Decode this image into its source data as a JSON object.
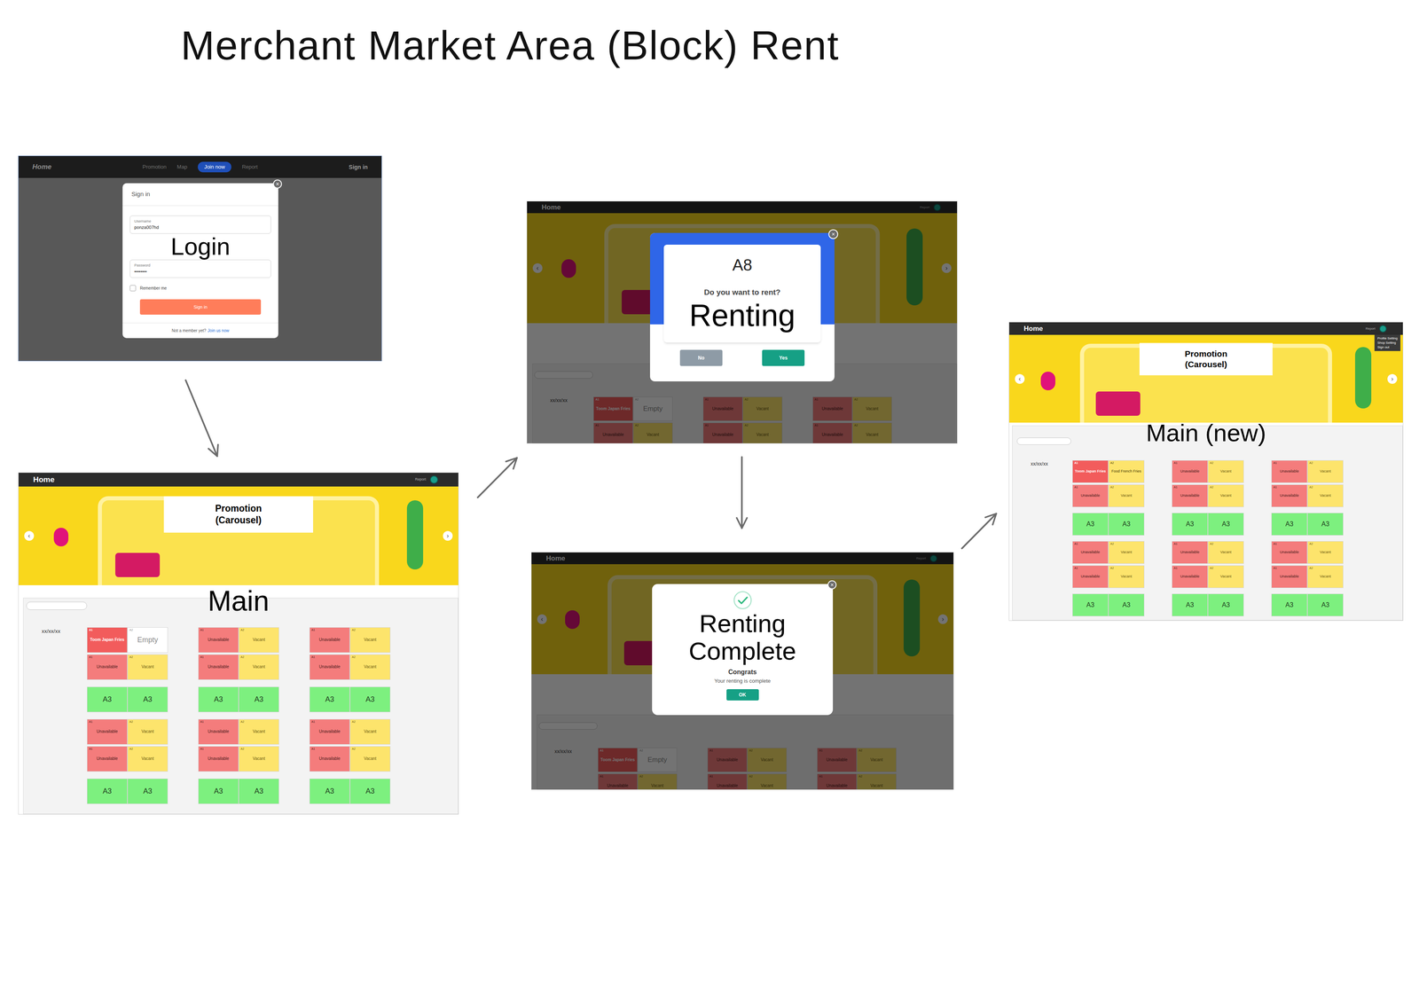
{
  "title": "Merchant Market Area (Block) Rent",
  "login": {
    "label": "Login",
    "nav": {
      "brand": "Home",
      "links": [
        {
          "label": "Promotion",
          "selected": false
        },
        {
          "label": "Map",
          "selected": false
        },
        {
          "label": "Join now",
          "selected": true
        },
        {
          "label": "Report",
          "selected": false
        }
      ],
      "signin": "Sign in"
    },
    "modal": {
      "title": "Sign in",
      "close": "×",
      "fields": [
        {
          "label": "Username",
          "value": "ponza007hd"
        },
        {
          "label": "Password",
          "value": "••••••••"
        }
      ],
      "remember": {
        "label": "Remember me",
        "checked": false
      },
      "button": "Sign in",
      "footer": "Not a member yet?",
      "link": "Join us now"
    }
  },
  "main": {
    "label": "Main",
    "nav": {
      "brand": "Home",
      "report": "Report"
    },
    "carousel": {
      "prev": "‹",
      "next": "›",
      "promo": "Promotion (Carousel)"
    },
    "date": "xx/xx/xx",
    "groups": [
      [
        [
          {
            "label": "A1",
            "text": "Toom Japan Fries",
            "status": "owned"
          },
          {
            "label": "A2",
            "text": "Empty",
            "status": "empty"
          }
        ],
        [
          {
            "label": "A1",
            "text": "Unavailable",
            "status": "occupied"
          },
          {
            "label": "A2",
            "text": "Vacant",
            "status": "vacant"
          }
        ],
        [
          {
            "text": "A3",
            "status": "available"
          },
          {
            "text": "A3",
            "status": "available"
          }
        ],
        [
          {
            "label": "A1",
            "text": "Unavailable",
            "status": "occupied"
          },
          {
            "label": "A2",
            "text": "Vacant",
            "status": "vacant"
          }
        ],
        [
          {
            "label": "A1",
            "text": "Unavailable",
            "status": "occupied"
          },
          {
            "label": "A2",
            "text": "Vacant",
            "status": "vacant"
          }
        ],
        [
          {
            "text": "A3",
            "status": "available"
          },
          {
            "text": "A3",
            "status": "available"
          }
        ]
      ],
      [
        [
          {
            "label": "A1",
            "text": "Unavailable",
            "status": "occupied"
          },
          {
            "label": "A2",
            "text": "Vacant",
            "status": "vacant"
          }
        ],
        [
          {
            "label": "A1",
            "text": "Unavailable",
            "status": "occupied"
          },
          {
            "label": "A2",
            "text": "Vacant",
            "status": "vacant"
          }
        ],
        [
          {
            "text": "A3",
            "status": "available"
          },
          {
            "text": "A3",
            "status": "available"
          }
        ],
        [
          {
            "label": "A1",
            "text": "Unavailable",
            "status": "occupied"
          },
          {
            "label": "A2",
            "text": "Vacant",
            "status": "vacant"
          }
        ],
        [
          {
            "label": "A1",
            "text": "Unavailable",
            "status": "occupied"
          },
          {
            "label": "A2",
            "text": "Vacant",
            "status": "vacant"
          }
        ],
        [
          {
            "text": "A3",
            "status": "available"
          },
          {
            "text": "A3",
            "status": "available"
          }
        ]
      ],
      [
        [
          {
            "label": "A1",
            "text": "Unavailable",
            "status": "occupied"
          },
          {
            "label": "A2",
            "text": "Vacant",
            "status": "vacant"
          }
        ],
        [
          {
            "label": "A1",
            "text": "Unavailable",
            "status": "occupied"
          },
          {
            "label": "A2",
            "text": "Vacant",
            "status": "vacant"
          }
        ],
        [
          {
            "text": "A3",
            "status": "available"
          },
          {
            "text": "A3",
            "status": "available"
          }
        ],
        [
          {
            "label": "A1",
            "text": "Unavailable",
            "status": "occupied"
          },
          {
            "label": "A2",
            "text": "Vacant",
            "status": "vacant"
          }
        ],
        [
          {
            "label": "A1",
            "text": "Unavailable",
            "status": "occupied"
          },
          {
            "label": "A2",
            "text": "Vacant",
            "status": "vacant"
          }
        ],
        [
          {
            "text": "A3",
            "status": "available"
          },
          {
            "text": "A3",
            "status": "available"
          }
        ]
      ]
    ]
  },
  "renting": {
    "screen": {
      "nav": {
        "brand": "Home",
        "report": "Report"
      },
      "carousel": {
        "prev": "‹",
        "next": "›"
      },
      "date": "xx/xx/xx",
      "groups": [
        [
          [
            {
              "label": "A1",
              "text": "Toom Japan Fries",
              "status": "owned"
            },
            {
              "label": "A2",
              "text": "Empty",
              "status": "empty"
            }
          ],
          [
            {
              "label": "A1",
              "text": "Unavailable",
              "status": "occupied"
            },
            {
              "label": "A2",
              "text": "Vacant",
              "status": "vacant"
            }
          ]
        ],
        [
          [
            {
              "label": "A1",
              "text": "Unavailable",
              "status": "occupied"
            },
            {
              "label": "A2",
              "text": "Vacant",
              "status": "vacant"
            }
          ],
          [
            {
              "label": "A1",
              "text": "Unavailable",
              "status": "occupied"
            },
            {
              "label": "A2",
              "text": "Vacant",
              "status": "vacant"
            }
          ]
        ],
        [
          [
            {
              "label": "A1",
              "text": "Unavailable",
              "status": "occupied"
            },
            {
              "label": "A2",
              "text": "Vacant",
              "status": "vacant"
            }
          ],
          [
            {
              "label": "A1",
              "text": "Unavailable",
              "status": "occupied"
            },
            {
              "label": "A2",
              "text": "Vacant",
              "status": "vacant"
            }
          ]
        ]
      ]
    },
    "dialog": {
      "block": "A8",
      "question": "Do you want to rent?",
      "label": "Renting",
      "close": "×",
      "buttons": [
        {
          "label": "No",
          "kind": "secondary"
        },
        {
          "label": "Yes",
          "kind": "primary"
        }
      ]
    }
  },
  "complete": {
    "screen": {
      "nav": {
        "brand": "Home",
        "report": "Report"
      },
      "carousel": {
        "prev": "‹",
        "next": "›"
      },
      "date": "xx/xx/xx",
      "groups": [
        [
          [
            {
              "label": "A1",
              "text": "Toom Japan Fries",
              "status": "owned"
            },
            {
              "label": "A2",
              "text": "Empty",
              "status": "empty"
            }
          ],
          [
            {
              "label": "A1",
              "text": "Unavailable",
              "status": "occupied"
            },
            {
              "label": "A2",
              "text": "Vacant",
              "status": "vacant"
            }
          ]
        ],
        [
          [
            {
              "label": "A1",
              "text": "Unavailable",
              "status": "occupied"
            },
            {
              "label": "A2",
              "text": "Vacant",
              "status": "vacant"
            }
          ],
          [
            {
              "label": "A1",
              "text": "Unavailable",
              "status": "occupied"
            },
            {
              "label": "A2",
              "text": "Vacant",
              "status": "vacant"
            }
          ]
        ],
        [
          [
            {
              "label": "A1",
              "text": "Unavailable",
              "status": "occupied"
            },
            {
              "label": "A2",
              "text": "Vacant",
              "status": "vacant"
            }
          ],
          [
            {
              "label": "A1",
              "text": "Unavailable",
              "status": "occupied"
            },
            {
              "label": "A2",
              "text": "Vacant",
              "status": "vacant"
            }
          ]
        ]
      ]
    },
    "dialog": {
      "label": "Renting Complete",
      "heading": "Congrats",
      "message": "Your renting is complete",
      "button": "OK",
      "close": "×"
    }
  },
  "main_new": {
    "label": "Main (new)",
    "nav": {
      "brand": "Home",
      "report": "Report",
      "menu": [
        "Profile Setting",
        "Shop Setting",
        "Sign out"
      ]
    },
    "carousel": {
      "prev": "‹",
      "next": "›",
      "promo": "Promotion (Carousel)"
    },
    "date": "xx/xx/xx",
    "groups": [
      [
        [
          {
            "label": "A1",
            "text": "Toom Japan Fries",
            "status": "owned"
          },
          {
            "label": "A2",
            "text": "Food French Fries",
            "status": "rented"
          }
        ],
        [
          {
            "label": "A1",
            "text": "Unavailable",
            "status": "occupied"
          },
          {
            "label": "A2",
            "text": "Vacant",
            "status": "vacant"
          }
        ],
        [
          {
            "text": "A3",
            "status": "available"
          },
          {
            "text": "A3",
            "status": "available"
          }
        ],
        [
          {
            "label": "A1",
            "text": "Unavailable",
            "status": "occupied"
          },
          {
            "label": "A2",
            "text": "Vacant",
            "status": "vacant"
          }
        ],
        [
          {
            "label": "A1",
            "text": "Unavailable",
            "status": "occupied"
          },
          {
            "label": "A2",
            "text": "Vacant",
            "status": "vacant"
          }
        ],
        [
          {
            "text": "A3",
            "status": "available"
          },
          {
            "text": "A3",
            "status": "available"
          }
        ]
      ],
      [
        [
          {
            "label": "A1",
            "text": "Unavailable",
            "status": "occupied"
          },
          {
            "label": "A2",
            "text": "Vacant",
            "status": "vacant"
          }
        ],
        [
          {
            "label": "A1",
            "text": "Unavailable",
            "status": "occupied"
          },
          {
            "label": "A2",
            "text": "Vacant",
            "status": "vacant"
          }
        ],
        [
          {
            "text": "A3",
            "status": "available"
          },
          {
            "text": "A3",
            "status": "available"
          }
        ],
        [
          {
            "label": "A1",
            "text": "Unavailable",
            "status": "occupied"
          },
          {
            "label": "A2",
            "text": "Vacant",
            "status": "vacant"
          }
        ],
        [
          {
            "label": "A1",
            "text": "Unavailable",
            "status": "occupied"
          },
          {
            "label": "A2",
            "text": "Vacant",
            "status": "vacant"
          }
        ],
        [
          {
            "text": "A3",
            "status": "available"
          },
          {
            "text": "A3",
            "status": "available"
          }
        ]
      ],
      [
        [
          {
            "label": "A1",
            "text": "Unavailable",
            "status": "occupied"
          },
          {
            "label": "A2",
            "text": "Vacant",
            "status": "vacant"
          }
        ],
        [
          {
            "label": "A1",
            "text": "Unavailable",
            "status": "occupied"
          },
          {
            "label": "A2",
            "text": "Vacant",
            "status": "vacant"
          }
        ],
        [
          {
            "text": "A3",
            "status": "available"
          },
          {
            "text": "A3",
            "status": "available"
          }
        ],
        [
          {
            "label": "A1",
            "text": "Unavailable",
            "status": "occupied"
          },
          {
            "label": "A2",
            "text": "Vacant",
            "status": "vacant"
          }
        ],
        [
          {
            "label": "A1",
            "text": "Unavailable",
            "status": "occupied"
          },
          {
            "label": "A2",
            "text": "Vacant",
            "status": "vacant"
          }
        ],
        [
          {
            "text": "A3",
            "status": "available"
          },
          {
            "text": "A3",
            "status": "available"
          }
        ]
      ]
    ]
  }
}
